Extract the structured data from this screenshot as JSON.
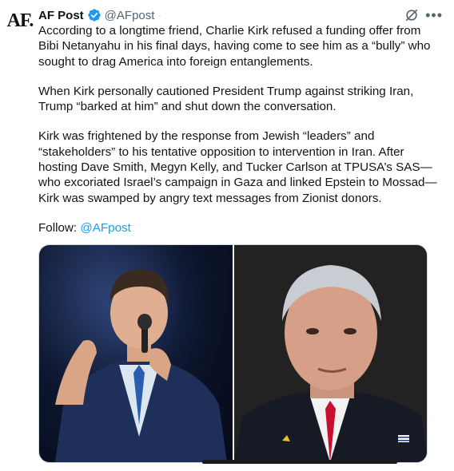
{
  "post": {
    "avatar_text": "AF.",
    "display_name": "AF Post",
    "handle": "@AFpost",
    "separator": "·",
    "paragraphs": [
      "According to a longtime friend, Charlie Kirk refused a funding offer from Bibi Netanyahu in his final days, having come to see him as a “bully” who sought to drag America into foreign entanglements.",
      "When Kirk personally cautioned President Trump against striking Iran, Trump “barked at him” and shut down the conversation.",
      "Kirk was frightened by the response from Jewish “leaders” and “stakeholders” to his tentative opposition to intervention in Iran. After hosting Dave Smith, Megyn Kelly, and Tucker Carlson at TPUSA’s SAS—who excoriated Israel’s campaign in Gaza and linked Epstein to Mossad—Kirk was swamped by angry text messages from Zionist donors."
    ],
    "follow_label": "Follow: ",
    "follow_link": "@AFpost"
  },
  "icons": {
    "verified": "verified-badge-icon",
    "grok": "grok-icon",
    "more": "more-options-icon"
  },
  "colors": {
    "link": "#1d9bf0",
    "verified": "#1d9bf0",
    "text": "#0f1419",
    "secondary": "#536471"
  }
}
